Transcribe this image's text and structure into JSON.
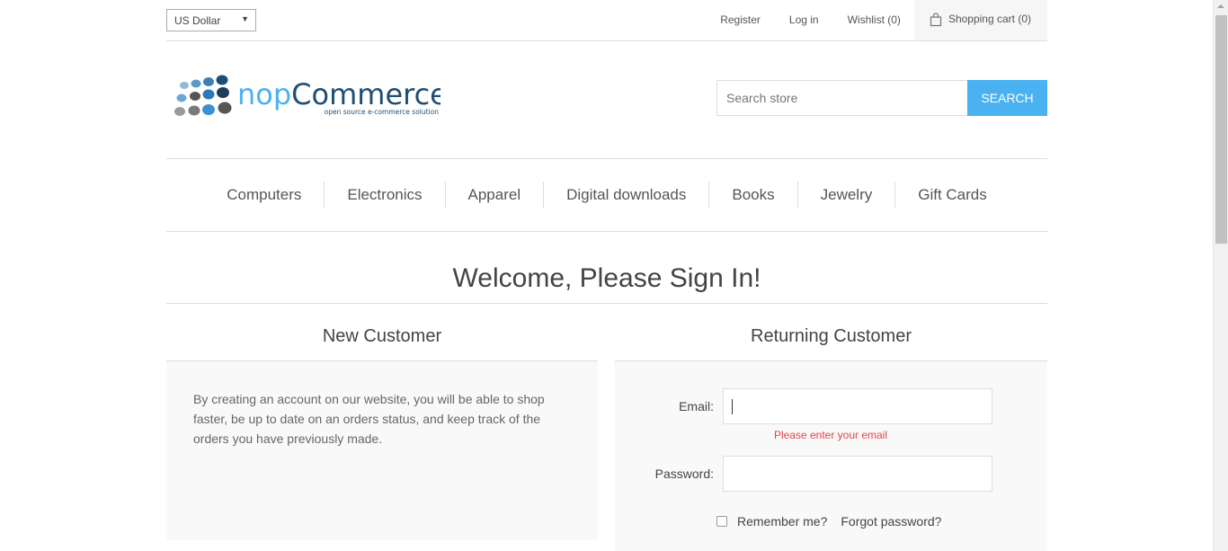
{
  "header": {
    "currency": "US Dollar",
    "links": {
      "register": "Register",
      "login": "Log in",
      "wishlist": "Wishlist (0)",
      "cart": "Shopping cart (0)"
    }
  },
  "logo": {
    "name": "nopCommerce",
    "tagline": "open source e-commerce solution"
  },
  "search": {
    "placeholder": "Search store",
    "button": "SEARCH"
  },
  "menu": [
    "Computers",
    "Electronics",
    "Apparel",
    "Digital downloads",
    "Books",
    "Jewelry",
    "Gift Cards"
  ],
  "page": {
    "title": "Welcome, Please Sign In!"
  },
  "new_customer": {
    "title": "New Customer",
    "text": "By creating an account on our website, you will be able to shop faster, be up to date on an orders status, and keep track of the orders you have previously made."
  },
  "returning_customer": {
    "title": "Returning Customer",
    "email_label": "Email:",
    "email_error": "Please enter your email",
    "password_label": "Password:",
    "remember_label": "Remember me?",
    "forgot_label": "Forgot password?"
  },
  "colors": {
    "accent": "#4ab2f1",
    "error": "#e4434b",
    "panel": "#f9f9f9"
  }
}
